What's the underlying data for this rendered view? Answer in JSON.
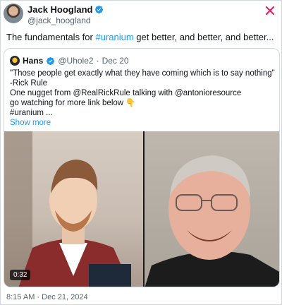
{
  "author": {
    "name": "Jack Hoogland",
    "handle": "@jack_hoogland"
  },
  "tweet": {
    "prefix": "The fundamentals for ",
    "hashtag": "#uranium",
    "suffix": " get better, and better, and better..."
  },
  "quote": {
    "name": "Hans",
    "handle": "@Uhole2",
    "separator": "·",
    "date": "Dec 20",
    "lines": [
      "\"Those people get exactly what they have coming which is to say nothing\"",
      "-Rick Rule",
      "One nugget from @RealRickRule talking with @antonioresource",
      "go watching for more link below 👇",
      "#uranium ..."
    ],
    "show_more": "Show more",
    "video": {
      "duration": "0:32"
    }
  },
  "timestamp": "8:15 AM · Dec 21, 2024",
  "icons": {
    "verified": "verified-badge-icon",
    "close": "close-icon"
  },
  "colors": {
    "accent": "#1d9bf0",
    "muted": "#536471",
    "close": "#e0245e"
  }
}
